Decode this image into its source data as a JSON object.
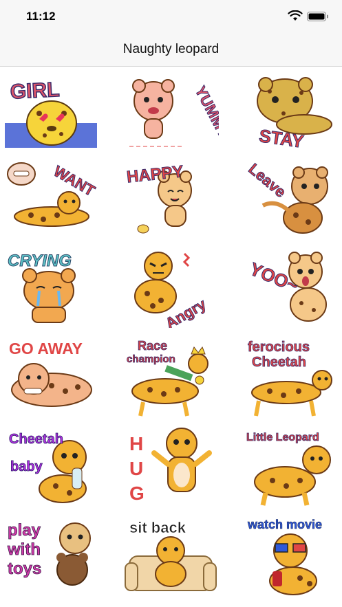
{
  "status_bar": {
    "time": "11:12",
    "icons": [
      "wifi-icon",
      "battery-icon"
    ]
  },
  "nav": {
    "title": "Naughty leopard"
  },
  "colors": {
    "fur": "#f2b233",
    "fur_light": "#f5c889",
    "spot": "#6b3a16",
    "bar_bg": "#f7f7f7",
    "blue_block": "#5b73d8",
    "red_text": "#e04646",
    "purple_text": "#8b2fc9",
    "blue_text": "#2f58d8"
  },
  "stickers": [
    {
      "id": "girl",
      "lines": [
        "GIRL"
      ],
      "icon": "leopard-hearts-icon"
    },
    {
      "id": "yummy",
      "lines": [
        "YUMMY"
      ],
      "icon": "leopard-licking-icon"
    },
    {
      "id": "stay",
      "lines": [
        "STAY"
      ],
      "icon": "leopard-lying-icon"
    },
    {
      "id": "want",
      "lines": [
        "WANT"
      ],
      "icon": "leopard-bone-dream-icon"
    },
    {
      "id": "happy",
      "lines": [
        "HAPPY"
      ],
      "icon": "leopard-dancing-icon"
    },
    {
      "id": "leave",
      "lines": [
        "Leave"
      ],
      "icon": "leopard-walking-away-icon"
    },
    {
      "id": "crying",
      "lines": [
        "CRYING"
      ],
      "icon": "leopard-crying-icon"
    },
    {
      "id": "angry",
      "lines": [
        "Angry"
      ],
      "icon": "leopard-angry-icon"
    },
    {
      "id": "yoo",
      "lines": [
        "YOO~"
      ],
      "icon": "leopard-surprised-icon"
    },
    {
      "id": "go-away",
      "lines": [
        "GO AWAY"
      ],
      "icon": "leopard-bone-lying-icon"
    },
    {
      "id": "race-champion",
      "lines": [
        "Race",
        "champion"
      ],
      "icon": "leopard-crown-icon"
    },
    {
      "id": "ferocious-cheetah",
      "lines": [
        "ferocious",
        "Cheetah"
      ],
      "icon": "leopard-prowling-icon"
    },
    {
      "id": "cheetah-baby",
      "lines": [
        "Cheetah",
        "baby"
      ],
      "icon": "leopard-baby-bottle-icon"
    },
    {
      "id": "hug",
      "lines": [
        "H",
        "U",
        "G"
      ],
      "icon": "leopard-hug-icon"
    },
    {
      "id": "little-leopard",
      "lines": [
        "Little Leopard"
      ],
      "icon": "leopard-standing-icon"
    },
    {
      "id": "play-with-toys",
      "lines": [
        "play",
        "with",
        "toys"
      ],
      "icon": "leopard-teddy-icon"
    },
    {
      "id": "sit-back",
      "lines": [
        "sit back"
      ],
      "icon": "leopard-sofa-icon"
    },
    {
      "id": "watch-movie",
      "lines": [
        "watch movie"
      ],
      "icon": "leopard-3d-glasses-icon"
    }
  ]
}
